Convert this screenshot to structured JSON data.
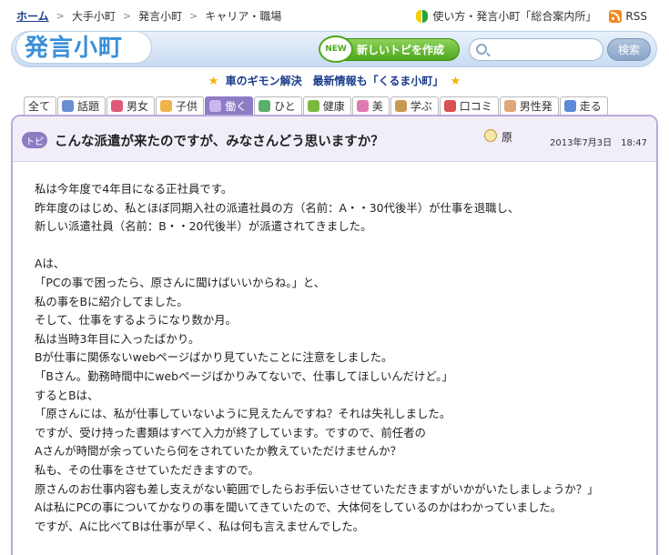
{
  "breadcrumb": {
    "home": "ホーム",
    "items": [
      "大手小町",
      "発言小町",
      "キャリア・職場"
    ]
  },
  "top_links": {
    "guide": "使い方・発言小町「総合案内所」",
    "rss": "RSS"
  },
  "header": {
    "logo": "発言小町",
    "new_badge": "NEW",
    "new_topic_button": "新しいトピを作成",
    "search_placeholder": "",
    "search_button": "検索"
  },
  "announcement": "車のギモン解決　最新情報も「くるま小町」",
  "tabs": [
    {
      "label": "全て",
      "icon": "none",
      "color": ""
    },
    {
      "label": "話題",
      "icon": "newspaper-icon",
      "color": "#6a8fd0"
    },
    {
      "label": "男女",
      "icon": "heart-icon",
      "color": "#e05a78"
    },
    {
      "label": "子供",
      "icon": "smile-icon",
      "color": "#f0b34a"
    },
    {
      "label": "働く",
      "icon": "briefcase-icon",
      "color": "#c9b8ee",
      "active": true
    },
    {
      "label": "ひと",
      "icon": "people-icon",
      "color": "#5ab06a"
    },
    {
      "label": "健康",
      "icon": "person-icon",
      "color": "#7ab840"
    },
    {
      "label": "美",
      "icon": "cosmetic-icon",
      "color": "#e07ab0"
    },
    {
      "label": "学ぶ",
      "icon": "book-icon",
      "color": "#c89a50"
    },
    {
      "label": "口コミ",
      "icon": "bus-icon",
      "color": "#d85050"
    },
    {
      "label": "男性発",
      "icon": "man-face-icon",
      "color": "#e0a878"
    },
    {
      "label": "走る",
      "icon": "runner-icon",
      "color": "#5a8ad8"
    }
  ],
  "topic": {
    "badge": "トピ",
    "title": "こんな派遣が来たのですが、みなさんどう思いますか？",
    "user_icon": "face-icon",
    "user": "原",
    "date": "2013年7月3日　18:47"
  },
  "body": [
    "私は今年度で4年目になる正社員です。",
    "昨年度のはじめ、私とほぼ同期入社の派遣社員の方（名前：A・・30代後半）が仕事を退職し、",
    "新しい派遣社員（名前：B・・20代後半）が派遣されてきました。",
    "",
    "Aは、",
    "「PCの事で困ったら、原さんに聞けばいいからね。」と、",
    "私の事をBに紹介してました。",
    "そして、仕事をするようになり数か月。",
    "私は当時3年目に入ったばかり。",
    "Bが仕事に関係ないwebページばかり見ていたことに注意をしました。",
    "「Bさん。勤務時間中にwebページばかりみてないで、仕事してほしいんだけど。」",
    "するとBは、",
    "「原さんには、私が仕事していないように見えたんですね？それは失礼しました。",
    "ですが、受け持った書類はすべて入力が終了しています。ですので、前任者の",
    "Aさんが時間が余っていたら何をされていたか教えていただけませんか？",
    "私も、その仕事をさせていただきますので。",
    "原さんのお仕事内容も差し支えがない範囲でしたらお手伝いさせていただきますがいかがいたしましょうか？」",
    "Aは私にPCの事についてかなりの事を聞いてきていたので、大体何をしているのかはわかっていました。",
    "ですが、Aに比べてBは仕事が早く、私は何も言えませんでした。"
  ]
}
